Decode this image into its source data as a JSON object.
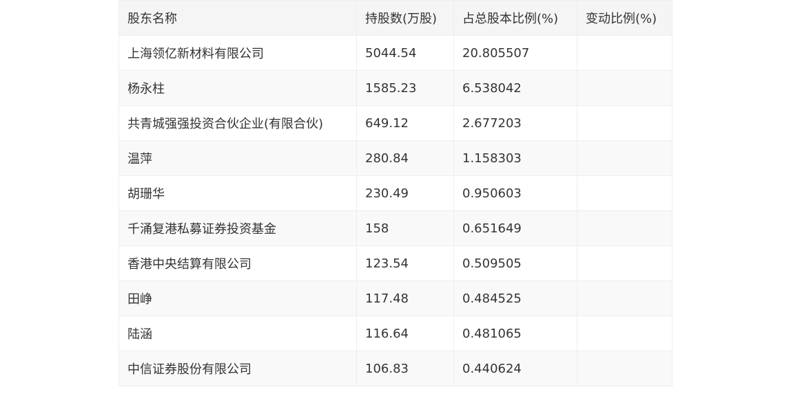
{
  "table": {
    "headers": [
      "股东名称",
      "持股数(万股)",
      "占总股本比例(%)",
      "变动比例(%)"
    ],
    "rows": [
      [
        "上海领亿新材料有限公司",
        "5044.54",
        "20.805507",
        ""
      ],
      [
        "杨永柱",
        "1585.23",
        "6.538042",
        ""
      ],
      [
        "共青城强强投资合伙企业(有限合伙)",
        "649.12",
        "2.677203",
        ""
      ],
      [
        "温萍",
        "280.84",
        "1.158303",
        ""
      ],
      [
        "胡珊华",
        "230.49",
        "0.950603",
        ""
      ],
      [
        "千涌复港私募证券投资基金",
        "158",
        "0.651649",
        ""
      ],
      [
        "香港中央结算有限公司",
        "123.54",
        "0.509505",
        ""
      ],
      [
        "田峥",
        "117.48",
        "0.484525",
        ""
      ],
      [
        "陆涵",
        "116.64",
        "0.481065",
        ""
      ],
      [
        "中信证券股份有限公司",
        "106.83",
        "0.440624",
        ""
      ]
    ]
  }
}
